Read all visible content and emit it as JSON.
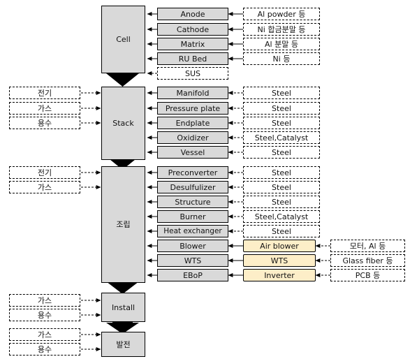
{
  "diagram": {
    "title": "Fuel cell manufacturing value chain flow",
    "colors": {
      "process_fill": "#d9d9d9",
      "component_fill": "#d9d9d9",
      "material_fill": "#ffffff",
      "highlight_fill": "#fdeec8",
      "stroke": "#000000"
    },
    "stages": [
      {
        "id": "cell",
        "label": "Cell"
      },
      {
        "id": "stack",
        "label": "Stack"
      },
      {
        "id": "assy",
        "label": "조립"
      },
      {
        "id": "install",
        "label": "Install"
      },
      {
        "id": "power",
        "label": "발전"
      }
    ],
    "utilities": {
      "stack": [
        {
          "label": "전기"
        },
        {
          "label": "가스"
        },
        {
          "label": "용수"
        }
      ],
      "assy": [
        {
          "label": "전기"
        },
        {
          "label": "가스"
        }
      ],
      "install": [
        {
          "label": "가스"
        },
        {
          "label": "용수"
        }
      ],
      "power": [
        {
          "label": "가스"
        },
        {
          "label": "용수"
        }
      ]
    },
    "rows": {
      "cell": [
        {
          "component": "Anode",
          "comp_style": "solid",
          "material": "Al powder 등",
          "mat_style": "dash",
          "link": "solid"
        },
        {
          "component": "Cathode",
          "comp_style": "solid",
          "material": "Ni 합금분말 등",
          "mat_style": "dash",
          "link": "solid"
        },
        {
          "component": "Matrix",
          "comp_style": "solid",
          "material": "Al 분말 등",
          "mat_style": "dash",
          "link": "solid"
        },
        {
          "component": "RU Bed",
          "comp_style": "solid",
          "material": "Ni 등",
          "mat_style": "dash",
          "link": "solid"
        },
        {
          "component": "SUS",
          "comp_style": "dash",
          "material": "",
          "mat_style": "none",
          "link": "dash"
        }
      ],
      "stack": [
        {
          "component": "Manifold",
          "comp_style": "solid",
          "material": "Steel",
          "mat_style": "dash",
          "link": "solid"
        },
        {
          "component": "Pressure plate",
          "comp_style": "solid",
          "material": "Steel",
          "mat_style": "dash",
          "link": "solid"
        },
        {
          "component": "Endplate",
          "comp_style": "solid",
          "material": "Steel",
          "mat_style": "dash",
          "link": "solid"
        },
        {
          "component": "Oxidizer",
          "comp_style": "solid",
          "material": "Steel,Catalyst",
          "mat_style": "dash",
          "link": "solid"
        },
        {
          "component": "Vessel",
          "comp_style": "solid",
          "material": "Steel",
          "mat_style": "dash",
          "link": "solid"
        }
      ],
      "assy": [
        {
          "component": "Preconverter",
          "comp_style": "solid",
          "material": "Steel",
          "mat_style": "dash",
          "link": "solid",
          "sub": ""
        },
        {
          "component": "Desulfulizer",
          "comp_style": "solid",
          "material": "Steel",
          "mat_style": "dash",
          "link": "solid",
          "sub": ""
        },
        {
          "component": "Structure",
          "comp_style": "solid",
          "material": "Steel",
          "mat_style": "dash",
          "link": "solid",
          "sub": ""
        },
        {
          "component": "Burner",
          "comp_style": "solid",
          "material": "Steel,Catalyst",
          "mat_style": "dash",
          "link": "solid",
          "sub": ""
        },
        {
          "component": "Heat exchanger",
          "comp_style": "solid",
          "material": "Steel",
          "mat_style": "dash",
          "link": "solid",
          "sub": ""
        },
        {
          "component": "Blower",
          "comp_style": "solid",
          "material": "Air blower",
          "mat_style": "yellow",
          "link": "solid",
          "sub": "모터, Al 등"
        },
        {
          "component": "WTS",
          "comp_style": "solid",
          "material": "WTS",
          "mat_style": "yellow",
          "link": "solid",
          "sub": "Glass fiber 등"
        },
        {
          "component": "EBoP",
          "comp_style": "solid",
          "material": "Inverter",
          "mat_style": "yellow",
          "link": "solid",
          "sub": "PCB 등"
        }
      ]
    },
    "icons": {
      "flow_arrow": "down-block-arrow-icon",
      "feed_arrow": "left-arrow-icon",
      "dashed_feed_arrow": "dashed-left-arrow-icon",
      "utility_arrow": "right-arrow-icon"
    }
  }
}
